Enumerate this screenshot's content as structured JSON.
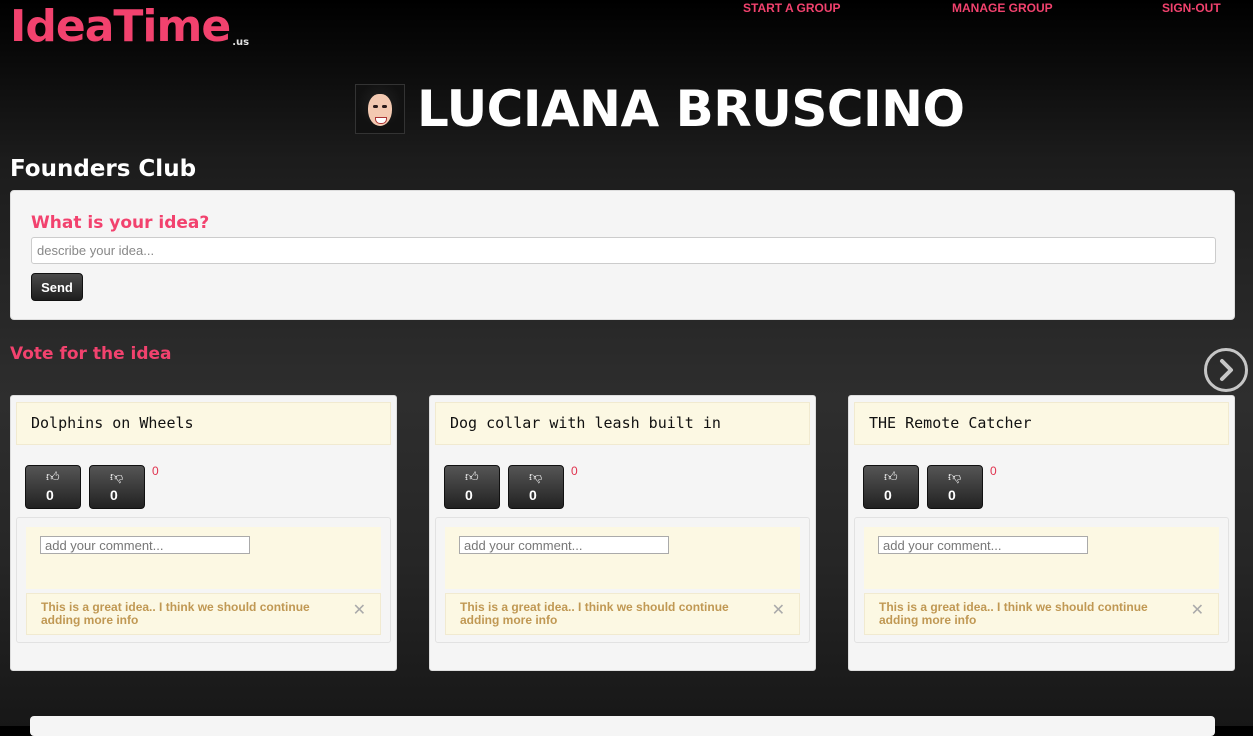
{
  "header": {
    "logo_main": "IdeaTime",
    "logo_suffix": ".us",
    "nav": [
      "START A GROUP",
      "MANAGE GROUP",
      "SIGN-OUT"
    ]
  },
  "profile": {
    "name": "LUCIANA BRUSCINO"
  },
  "group": {
    "title": "Founders Club"
  },
  "idea_form": {
    "question": "What is your idea?",
    "placeholder": "describe your idea...",
    "send_label": "Send"
  },
  "vote_section": {
    "title": "Vote for the idea"
  },
  "ideas": [
    {
      "title": "Dolphins on Wheels",
      "upvotes": "0",
      "downvotes": "0",
      "score": "0",
      "comment_placeholder": "add your comment...",
      "comment": "This is a great idea.. I think we should continue adding more info"
    },
    {
      "title": "Dog collar with leash built in",
      "upvotes": "0",
      "downvotes": "0",
      "score": "0",
      "comment_placeholder": "add your comment...",
      "comment": "This is a great idea.. I think we should continue adding more info"
    },
    {
      "title": "THE Remote Catcher",
      "upvotes": "0",
      "downvotes": "0",
      "score": "0",
      "comment_placeholder": "add your comment...",
      "comment": "This is a great idea.. I think we should continue adding more info"
    }
  ],
  "icons": {
    "upvote": "thumbs-up-icon",
    "downvote": "thumbs-down-icon",
    "next": "chevron-right-icon",
    "close": "close-icon"
  },
  "colors": {
    "accent": "#f2426e",
    "card_highlight": "#fcf8e3",
    "comment_text": "#c09853"
  }
}
